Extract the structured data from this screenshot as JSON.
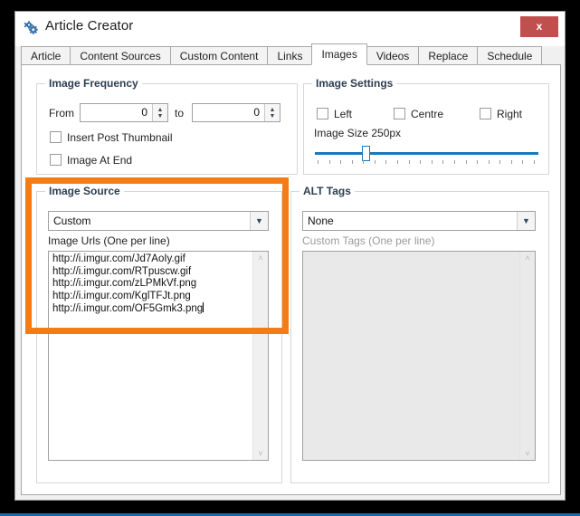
{
  "window": {
    "title": "Article Creator",
    "icon": "gears-icon",
    "close_label": "x",
    "close_color": "#c0504d"
  },
  "tabs": [
    {
      "label": "Article",
      "selected": false
    },
    {
      "label": "Content Sources",
      "selected": false
    },
    {
      "label": "Custom Content",
      "selected": false
    },
    {
      "label": "Links",
      "selected": false
    },
    {
      "label": "Images",
      "selected": true
    },
    {
      "label": "Videos",
      "selected": false
    },
    {
      "label": "Replace",
      "selected": false
    },
    {
      "label": "Schedule",
      "selected": false
    }
  ],
  "image_frequency": {
    "title": "Image Frequency",
    "from_label": "From",
    "from_value": "0",
    "to_label": "to",
    "to_value": "0",
    "checkboxes": [
      {
        "label": "Insert Post Thumbnail",
        "checked": false
      },
      {
        "label": "Image At End",
        "checked": false
      }
    ]
  },
  "image_settings": {
    "title": "Image Settings",
    "alignment": [
      {
        "label": "Left",
        "checked": false
      },
      {
        "label": "Centre",
        "checked": false
      },
      {
        "label": "Right",
        "checked": false
      }
    ],
    "size_label": "Image Size 250px",
    "slider": {
      "value": 250,
      "min": 0,
      "max": 1000,
      "thumb_percent": 22,
      "tick_count": 20,
      "accent": "#1a79bd"
    }
  },
  "image_source": {
    "title": "Image Source",
    "source_select": {
      "value": "Custom",
      "arrow": "chevron-down-icon"
    },
    "urls_label": "Image Urls (One per line)",
    "urls": [
      "http://i.imgur.com/Jd7AoIy.gif",
      "http://i.imgur.com/RTpuscw.gif",
      "http://i.imgur.com/zLPMkVf.png",
      "http://i.imgur.com/KglTFJt.png",
      "http://i.imgur.com/OF5Gmk3.png"
    ],
    "urls_text": "http://i.imgur.com/Jd7AoIy.gif\nhttp://i.imgur.com/RTpuscw.gif\nhttp://i.imgur.com/zLPMkVf.png\nhttp://i.imgur.com/KglTFJt.png\nhttp://i.imgur.com/OF5Gmk3.png"
  },
  "alt_tags": {
    "title": "ALT Tags",
    "tag_select": {
      "value": "None",
      "arrow": "chevron-down-icon"
    },
    "custom_label": "Custom Tags (One per line)",
    "custom_text": "",
    "disabled": true
  },
  "annotation": {
    "highlight_color": "#f57c14",
    "target": "image-source-group"
  },
  "scrollbar": {
    "up": "˄",
    "down": "˅"
  }
}
